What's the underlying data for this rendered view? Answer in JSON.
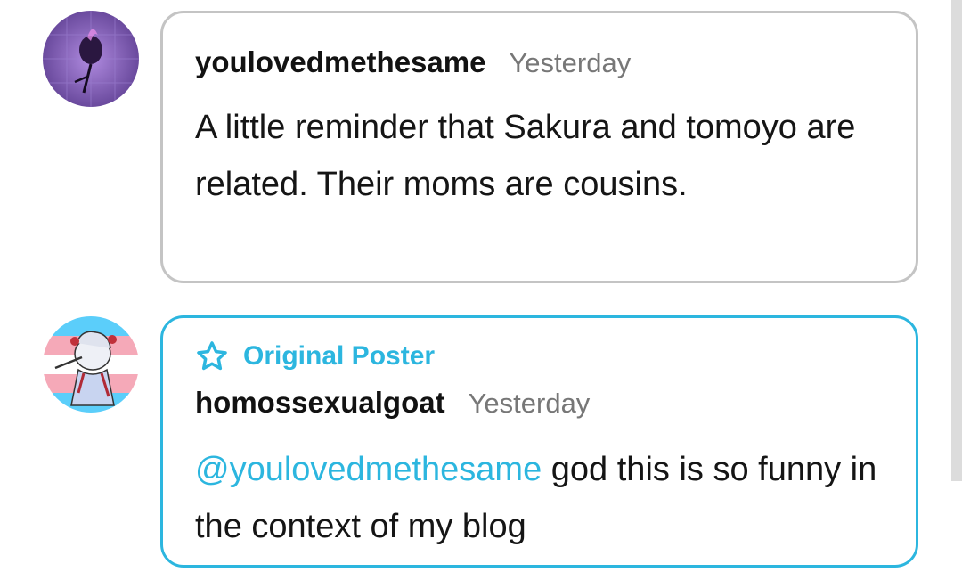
{
  "comments": [
    {
      "username": "youlovedmethesame",
      "timestamp": "Yesterday",
      "text": "A little reminder that Sakura and tomoyo are related. Their moms are cousins.",
      "avatar": "purple-rose-avatar"
    },
    {
      "badge": "Original Poster",
      "badge_icon": "star-outline-icon",
      "username": "homossexualgoat",
      "timestamp": "Yesterday",
      "mention": "@youlovedmethesame",
      "text": " god this is so funny in the context of my blog",
      "avatar": "trans-flag-character-avatar"
    }
  ],
  "colors": {
    "accent": "#2cb6df",
    "border_default": "#c4c4c4",
    "timestamp": "#777777",
    "text": "#151515"
  }
}
